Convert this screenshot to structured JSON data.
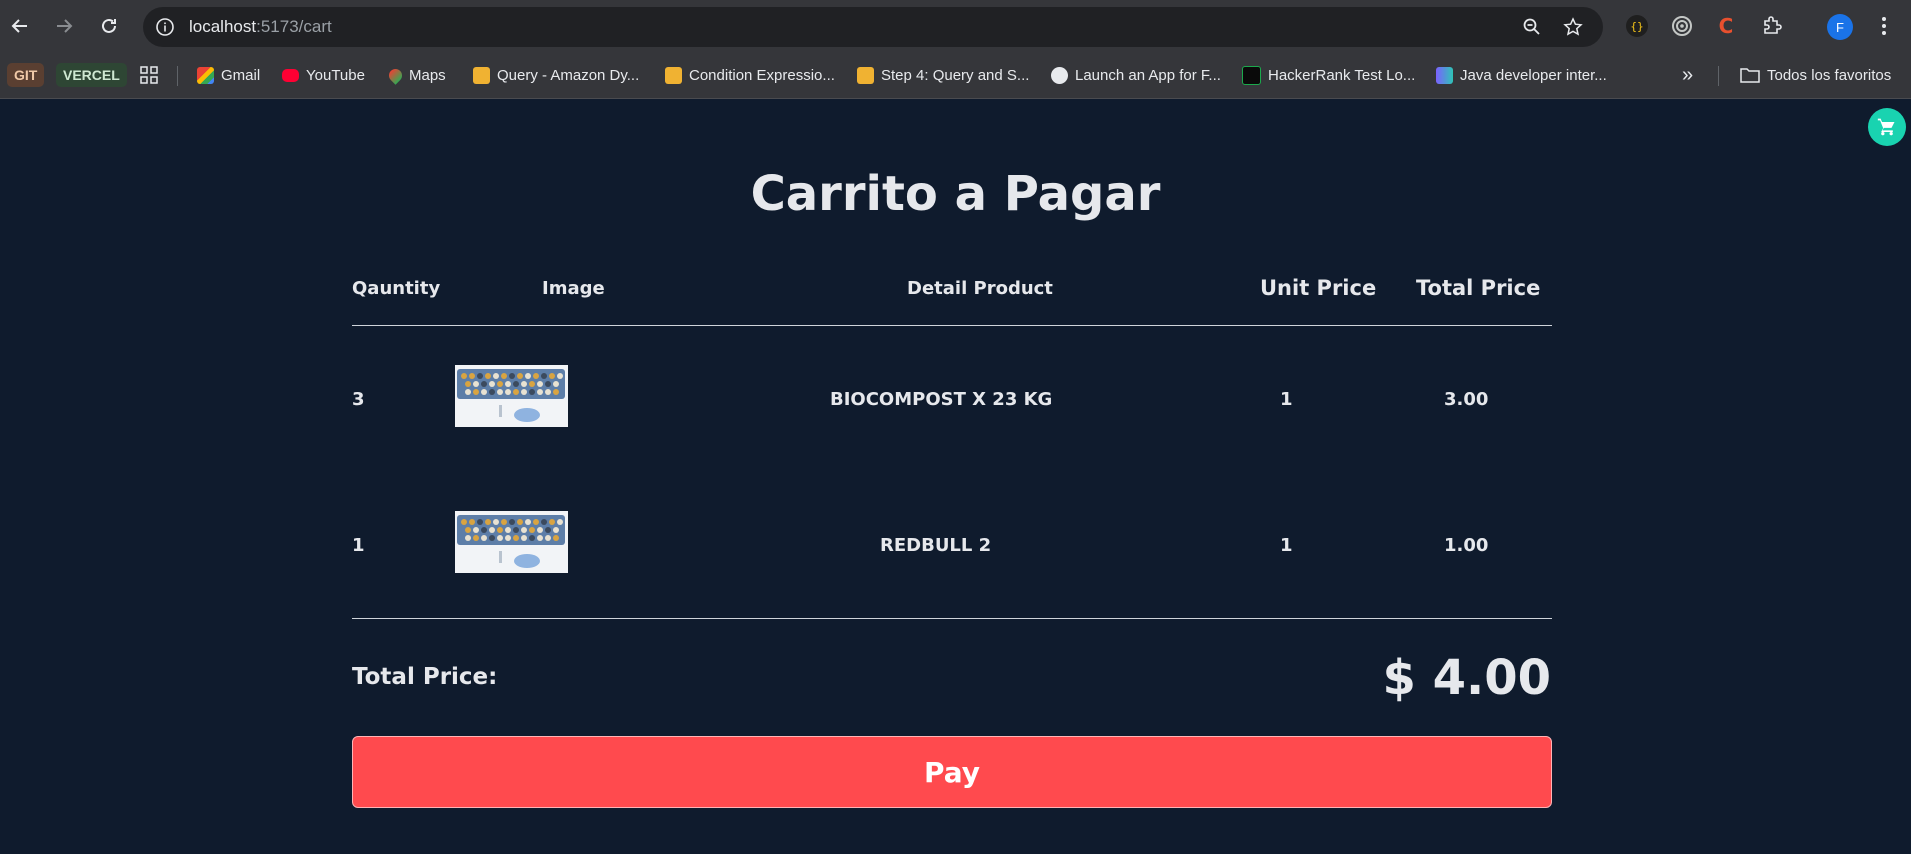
{
  "browser": {
    "url_host": "localhost",
    "url_path": ":5173/cart",
    "profile_initial": "F",
    "bookmarks": {
      "git": "GIT",
      "vercel": "VERCEL",
      "gmail": "Gmail",
      "youtube": "YouTube",
      "maps": "Maps",
      "query_amazon": "Query - Amazon Dy...",
      "condition_expr": "Condition Expressio...",
      "step4": "Step 4: Query and S...",
      "launch_app": "Launch an App for F...",
      "hackerrank": "HackerRank Test Lo...",
      "java_dev": "Java developer inter...",
      "overflow": "»",
      "all_favorites": "Todos los favoritos"
    }
  },
  "page": {
    "title": "Carrito a Pagar",
    "headers": {
      "quantity": "Qauntity",
      "image": "Image",
      "detail": "Detail Product",
      "unit_price": "Unit Price",
      "total_price": "Total Price"
    },
    "items": [
      {
        "quantity": "3",
        "name": "BIOCOMPOST X 23 KG",
        "unit_price": "1",
        "total_price": "3.00"
      },
      {
        "quantity": "1",
        "name": "REDBULL 2",
        "unit_price": "1",
        "total_price": "1.00"
      }
    ],
    "total_label": "Total Price:",
    "total_value": "$ 4.00",
    "pay_label": "Pay"
  },
  "colors": {
    "background": "#0f1b2d",
    "pay_button": "#ff4a4e",
    "cart_fab": "#19d3b0"
  },
  "icons": [
    "back-icon",
    "forward-icon",
    "reload-icon",
    "site-info-icon",
    "zoom-icon",
    "star-icon",
    "extensions-icon",
    "menu-icon",
    "cart-icon",
    "folder-icon"
  ]
}
